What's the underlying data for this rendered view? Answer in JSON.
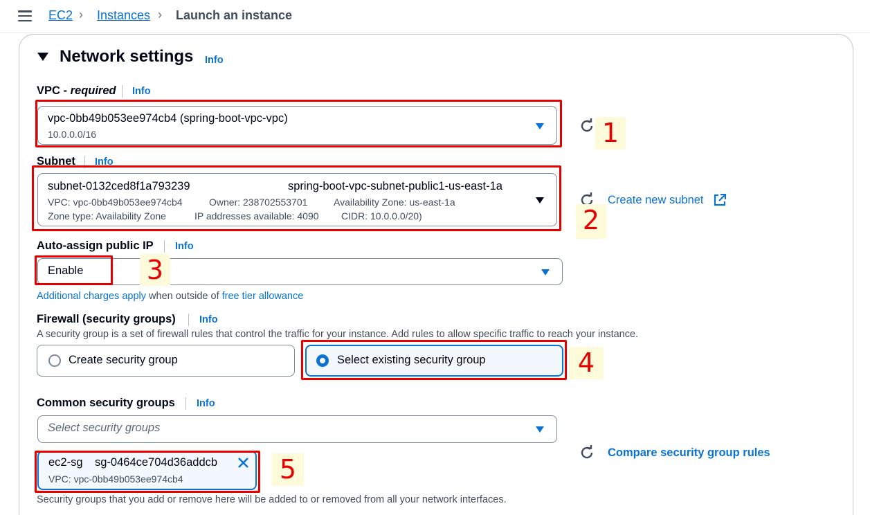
{
  "breadcrumb": {
    "items": [
      "EC2",
      "Instances"
    ],
    "current": "Launch an instance",
    "separator": "›"
  },
  "section": {
    "title": "Network settings",
    "info": "Info"
  },
  "vpc": {
    "label_prefix": "VPC - ",
    "label_required": "required",
    "info": "Info",
    "value": "vpc-0bb49b053ee974cb4 (spring-boot-vpc-vpc)",
    "cidr": "10.0.0.0/16"
  },
  "subnet": {
    "label": "Subnet",
    "info": "Info",
    "id": "subnet-0132ced8f1a793239",
    "name": "spring-boot-vpc-subnet-public1-us-east-1a",
    "line2_vpc": "VPC: vpc-0bb49b053ee974cb4",
    "line2_owner": "Owner: 238702553701",
    "line2_az": "Availability Zone: us-east-1a",
    "line3_zone": "Zone type: Availability Zone",
    "line3_ips": "IP addresses available: 4090",
    "line3_cidr": "CIDR: 10.0.0.0/20)",
    "create_link": "Create new subnet"
  },
  "public_ip": {
    "label": "Auto-assign public IP",
    "info": "Info",
    "value": "Enable",
    "note_link1": "Additional charges apply",
    "note_mid": " when outside of ",
    "note_link2": "free tier allowance"
  },
  "firewall": {
    "label": "Firewall (security groups)",
    "info": "Info",
    "description": "A security group is a set of firewall rules that control the traffic for your instance. Add rules to allow specific traffic to reach your instance.",
    "option_create": "Create security group",
    "option_existing": "Select existing security group",
    "selected": "existing"
  },
  "common_sg": {
    "label": "Common security groups",
    "info": "Info",
    "placeholder": "Select security groups",
    "token_name": "ec2-sg",
    "token_id": "sg-0464ce704d36addcb",
    "token_vpc": "VPC: vpc-0bb49b053ee974cb4",
    "compare_link": "Compare security group rules",
    "footer": "Security groups that you add or remove here will be added to or removed from all your network interfaces."
  },
  "annotations": [
    "1",
    "2",
    "3",
    "4",
    "5"
  ],
  "colors": {
    "link": "#0972d3",
    "annotation": "#e60000",
    "annotation_bg": "#fdfbd9"
  }
}
